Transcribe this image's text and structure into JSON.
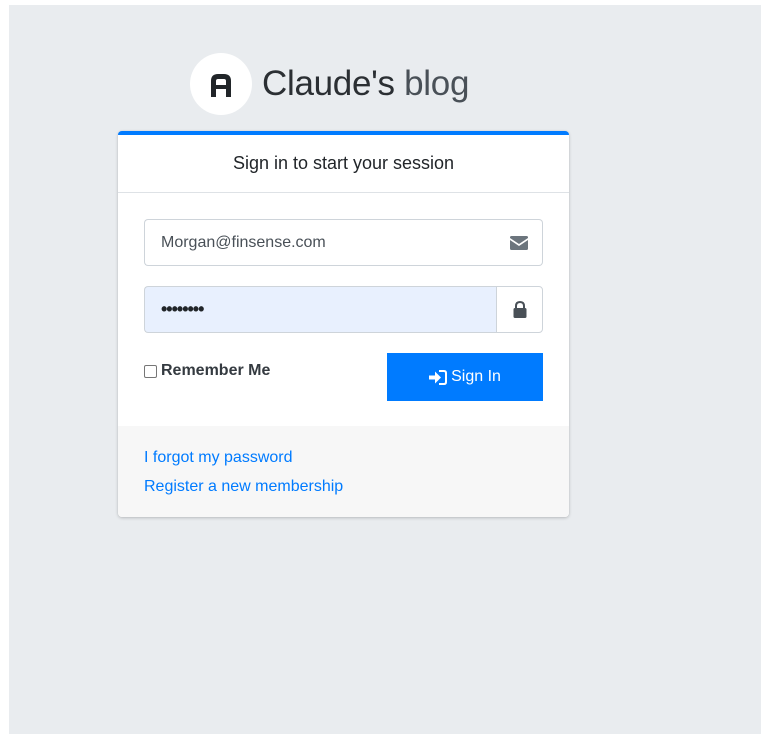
{
  "brand": {
    "name_bold": "Claude's",
    "name_light": "blog"
  },
  "card": {
    "header": "Sign in to start your session"
  },
  "form": {
    "email_value": "Morgan@finsense.com",
    "password_value": "••••••••",
    "remember_label": "Remember Me",
    "signin_label": "Sign In"
  },
  "footer": {
    "forgot_link": "I forgot my password",
    "register_link": "Register a new membership"
  },
  "icons": {
    "logo": "a-logo-icon",
    "email": "envelope-icon",
    "password": "lock-icon",
    "signin": "sign-in-icon"
  },
  "colors": {
    "accent": "#007bff",
    "background": "#e9ecef",
    "autofill": "#e8f0fe"
  }
}
